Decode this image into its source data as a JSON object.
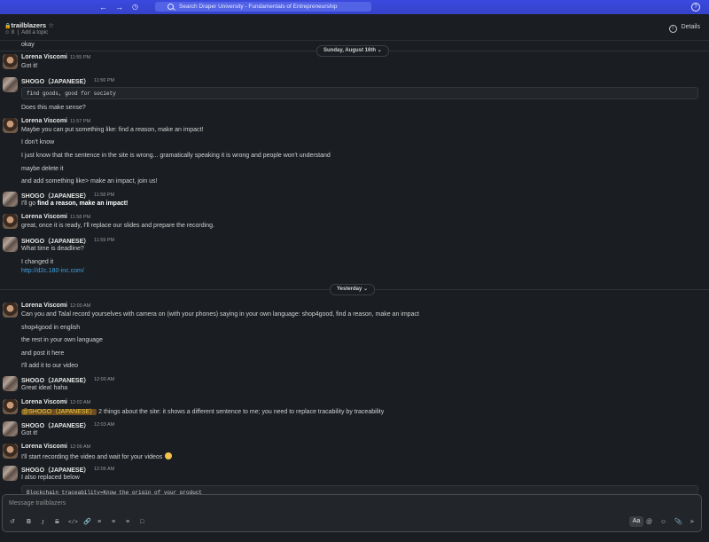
{
  "search": {
    "placeholder": "Search Draper University - Fundamentals of Entrepreneurship"
  },
  "channel": {
    "name": "trailblazers",
    "members": "8",
    "add_topic": "Add a topic",
    "details": "Details"
  },
  "date_dividers": {
    "first": "Sunday, August 16th",
    "second": "Yesterday"
  },
  "messages": {
    "m0": "okay",
    "m1": {
      "name": "Lorena Viscomi",
      "time": "11:55 PM",
      "lines": [
        "Got it!"
      ]
    },
    "m2": {
      "name": "SHOGO（JAPANESE）",
      "time": "11:56 PM",
      "code": "find goods, good for society",
      "lines": [
        "Does this make sense?"
      ]
    },
    "m3": {
      "name": "Lorena Viscomi",
      "time": "11:57 PM",
      "lines": [
        "Maybe you can put something like: find a reason, make an impact!",
        "I don't know",
        "I just know that  the sentence in the site is wrong... gramatically speaking it is wrong and people won't understand",
        "maybe delete it",
        "and add something like> make an impact, join us!"
      ]
    },
    "m4": {
      "name": "SHOGO（JAPANESE）",
      "time": "11:58 PM",
      "pre": "I'll go ",
      "bold": "find a reason, make an impact!"
    },
    "m5": {
      "name": "Lorena Viscomi",
      "time": "11:58 PM",
      "lines": [
        "great, once it is ready, I'll replace our slides and prepare the recording."
      ]
    },
    "m6": {
      "name": "SHOGO（JAPANESE）",
      "time": "11:59 PM",
      "lines": [
        "What time is deadline?",
        "I changed  it"
      ],
      "link": "http://d2c.180-inc.com/"
    },
    "m7": {
      "name": "Lorena Viscomi",
      "time": "12:00 AM",
      "lines": [
        "Can you and Talal record yourselves with camera on (with your phones) saying in your own language: shop4good, find a reason, make an impact",
        "shop4good in english",
        "the rest in your own language",
        "and post it here",
        "I'll add it to our video"
      ]
    },
    "m8": {
      "name": "SHOGO（JAPANESE）",
      "time": "12:00 AM",
      "lines": [
        "Great idea! haha"
      ]
    },
    "m9": {
      "name": "Lorena Viscomi",
      "time": "12:02 AM",
      "mention": "@SHOGO（JAPANESE）",
      "rest": " 2 things about the site: it shows a different sentence to me; you need to replace tracability by traceability"
    },
    "m10": {
      "name": "SHOGO（JAPANESE）",
      "time": "12:03 AM",
      "lines": [
        "Got it!"
      ]
    },
    "m11": {
      "name": "Lorena Viscomi",
      "time": "12:06 AM",
      "lines": [
        "I'll start recording the video and wait for your videos"
      ]
    },
    "m12": {
      "name": "SHOGO（JAPANESE）",
      "time": "12:06 AM",
      "lines": [
        "I also replaced below"
      ],
      "code": "Blockchain traceability=Know the origin of your product"
    }
  },
  "composer": {
    "placeholder": "Message trailblazers",
    "format_label": "Aa"
  },
  "colors": {
    "topbar": "#3b49df",
    "background": "#1a1d21",
    "link": "#3fa2e3",
    "mention_bg": "#6b4d1f",
    "mention_fg": "#f2c744"
  },
  "icons": [
    "back-arrow-icon",
    "forward-arrow-icon",
    "history-clock-icon",
    "search-icon",
    "help-icon",
    "lock-icon",
    "star-icon",
    "member-icon",
    "info-icon",
    "chevron-down-icon",
    "plus-icon",
    "bold-icon",
    "italic-icon",
    "strikethrough-icon",
    "code-icon",
    "link-icon",
    "ordered-list-icon",
    "bulleted-list-icon",
    "blockquote-icon",
    "code-block-icon",
    "mention-icon",
    "emoji-icon",
    "attach-icon",
    "send-icon"
  ]
}
